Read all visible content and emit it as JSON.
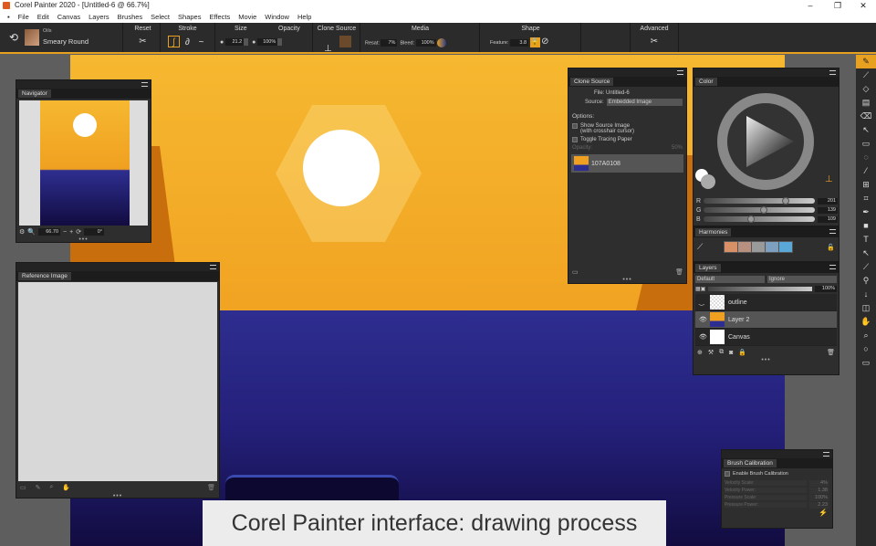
{
  "window": {
    "title": "Corel Painter 2020 - [Untitled-6 @ 66.7%]",
    "min": "–",
    "max": "❐",
    "close": "✕"
  },
  "menu": [
    "File",
    "Edit",
    "Canvas",
    "Layers",
    "Brushes",
    "Select",
    "Shapes",
    "Effects",
    "Movie",
    "Window",
    "Help"
  ],
  "toolbar": {
    "brush_category": "Oils",
    "brush_name": "Smeary Round",
    "reset": "Reset",
    "stroke": "Stroke",
    "size": "Size",
    "size_value": "21.2",
    "opacity": "Opacity",
    "opacity_value": "100%",
    "clone_source": "Clone Source",
    "media": "Media",
    "resat_label": "Resat:",
    "resat_value": "7%",
    "bleed_label": "Bleed:",
    "bleed_value": "100%",
    "shape": "Shape",
    "feature_label": "Feature:",
    "feature_value": "3.8",
    "advanced": "Advanced"
  },
  "navigator": {
    "title": "Navigator",
    "zoom": "66.70",
    "rotation": "0°"
  },
  "reference": {
    "title": "Reference Image"
  },
  "clone": {
    "title": "Clone Source",
    "file_label": "File:",
    "file_value": "Untitled-6",
    "source_label": "Source:",
    "source_value": "Embedded Image",
    "options": "Options:",
    "show_source": "Show Source Image",
    "show_source_sub": "(with crosshair cursor)",
    "toggle_tracing": "Toggle Tracing Paper",
    "opacity_label": "Opacity:",
    "opacity_value": "50%",
    "item": "107A0108"
  },
  "color": {
    "title": "Color",
    "r_label": "R",
    "r": "201",
    "g_label": "G",
    "g": "139",
    "b_label": "B",
    "b": "109",
    "r_frac": 0.74,
    "g_frac": 0.54,
    "b_frac": 0.43
  },
  "harmonies": {
    "title": "Harmonies",
    "swatches": [
      "#d89066",
      "#b89080",
      "#9a9a9a",
      "#7ea0c0",
      "#5aa8d8"
    ]
  },
  "layers": {
    "title": "Layers",
    "composite": "Default",
    "depth": "Ignore",
    "opacity": "100%",
    "items": [
      {
        "name": "outline"
      },
      {
        "name": "Layer 2"
      },
      {
        "name": "Canvas"
      }
    ]
  },
  "calibration": {
    "title": "Brush Calibration",
    "enable": "Enable Brush Calibration",
    "rows": [
      {
        "label": "Velocity Scale:",
        "value": "4%"
      },
      {
        "label": "Velocity Power:",
        "value": "1.38"
      },
      {
        "label": "Pressure Scale:",
        "value": "100%"
      },
      {
        "label": "Pressure Power:",
        "value": "2.23"
      }
    ]
  },
  "caption": "Corel Painter interface: drawing process"
}
